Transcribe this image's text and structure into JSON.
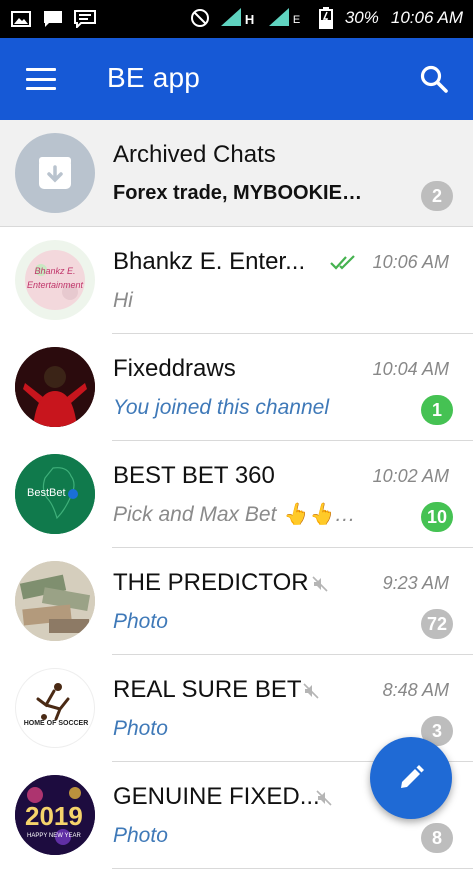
{
  "status_bar": {
    "battery": "30%",
    "time": "10:06 AM",
    "net1": "H",
    "net2": "E"
  },
  "app_bar": {
    "title": "BE app"
  },
  "chats": [
    {
      "title": "Archived Chats",
      "subtitle_lead": "Forex trade",
      "subtitle_rest": ", MYBOOKIE…",
      "time": "",
      "badge": "2",
      "badge_color": "grey"
    },
    {
      "title": "Bhankz E. Enter...",
      "subtitle": "Hi",
      "time": "10:06 AM",
      "badge": "",
      "read": true
    },
    {
      "title": "Fixeddraws",
      "subtitle": "You joined this channel",
      "time": "10:04 AM",
      "badge": "1",
      "badge_color": "green"
    },
    {
      "title": "BEST BET 360",
      "subtitle": "Pick and Max Bet 👆👆…",
      "time": "10:02 AM",
      "badge": "10",
      "badge_color": "green"
    },
    {
      "title": "THE PREDICTOR",
      "subtitle": "Photo",
      "time": "9:23 AM",
      "badge": "72",
      "badge_color": "grey",
      "muted": true
    },
    {
      "title": "REAL SURE BET",
      "subtitle": "Photo",
      "time": "8:48 AM",
      "badge": "3",
      "badge_color": "grey",
      "muted": true
    },
    {
      "title": "GENUINE FIXED...",
      "subtitle": "Photo",
      "time": "",
      "badge": "8",
      "badge_color": "grey",
      "muted": true
    }
  ],
  "avatars": {
    "bhankz_text": "Bhankz E. Entertainment",
    "bestbet_text": "BestBet",
    "soccer_text": "HOME OF SOCCER",
    "year_text": "2019",
    "year_sub": "HAPPY NEW YEAR"
  },
  "colors": {
    "app_bar": "#1659d6",
    "badge_green": "#45c253",
    "badge_grey": "#bdbdbd",
    "link_blue": "#3f79b8"
  },
  "icons": {
    "menu": "menu-icon",
    "search": "search-icon",
    "compose": "pencil-icon",
    "archive": "archive-icon",
    "read": "double-check-icon",
    "muted": "mute-icon"
  }
}
